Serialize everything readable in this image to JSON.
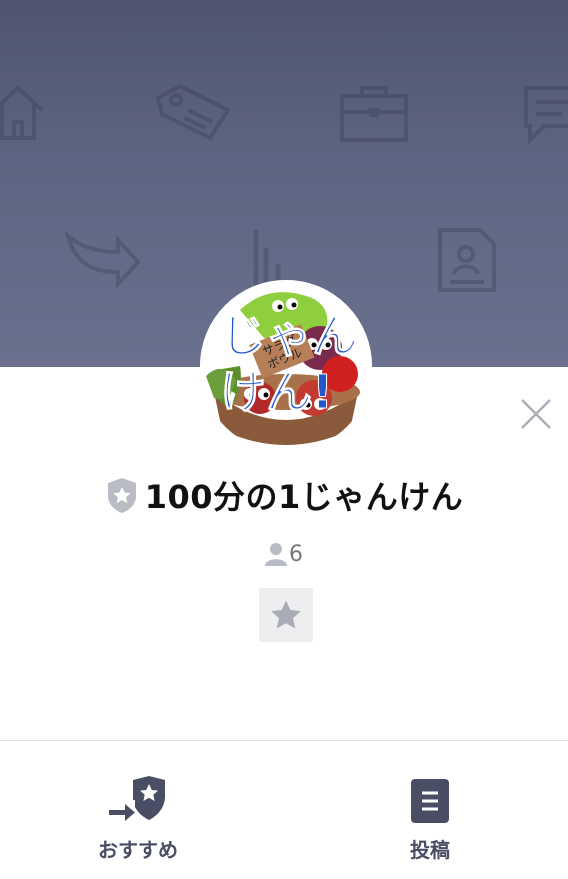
{
  "group": {
    "name": "100分の1じゃんけん",
    "member_count": "6",
    "avatar_caption": "じゃんけん!",
    "avatar_subcaption": "サラダボウル"
  },
  "tabs": [
    {
      "label": "おすすめ",
      "icon": "recommend-icon"
    },
    {
      "label": "投稿",
      "icon": "post-icon"
    }
  ],
  "icons": {
    "close": "close-icon",
    "favorite": "star-icon",
    "verified": "shield-star-icon",
    "members": "person-icon"
  },
  "colors": {
    "header_top": "#4f5570",
    "header_bottom": "#6a718e",
    "tab_accent": "#4a4e64",
    "avatar_text": "#2457c8"
  }
}
